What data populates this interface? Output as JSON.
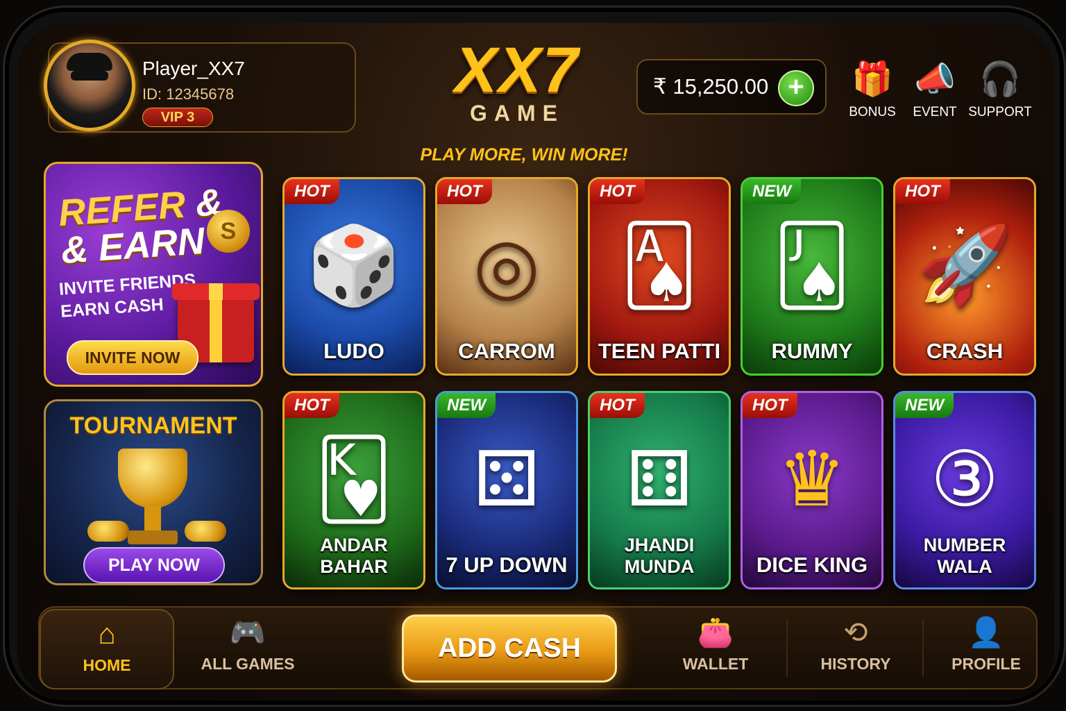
{
  "profile": {
    "name": "Player_XX7",
    "id": "ID: 12345678",
    "vip": "VIP 3"
  },
  "logo": {
    "main": "XX7",
    "sub": "GAME",
    "tagline": "PLAY MORE, WIN MORE!"
  },
  "balance": {
    "amount": "₹ 15,250.00",
    "add_symbol": "+"
  },
  "top_icons": [
    {
      "label": "BONUS",
      "icon": "gift-icon",
      "glyph": "🎁"
    },
    {
      "label": "EVENT",
      "icon": "megaphone-icon",
      "glyph": "📣"
    },
    {
      "label": "SUPPORT",
      "icon": "headset-icon",
      "glyph": "🎧"
    }
  ],
  "refer": {
    "title_line1": "REFER",
    "amp": "&",
    "title_line2": "& EARN",
    "sub_line1": "INVITE FRIENDS",
    "sub_line2": "EARN CASH",
    "button": "INVITE NOW",
    "coin_symbol": "S"
  },
  "tournament": {
    "title": "TOURNAMENT",
    "button": "PLAY NOW"
  },
  "games": [
    {
      "name": "LUDO",
      "badge": "HOT",
      "glyph": "🎲",
      "accent": "#1b4aa8"
    },
    {
      "name": "CARROM",
      "badge": "HOT",
      "glyph": "◎",
      "accent": "#b5824a"
    },
    {
      "name": "TEEN PATTI",
      "badge": "HOT",
      "glyph": "🂡",
      "accent": "#a01810"
    },
    {
      "name": "RUMMY",
      "badge": "NEW",
      "glyph": "🂫",
      "accent": "#1e7a1a"
    },
    {
      "name": "CRASH",
      "badge": "HOT",
      "glyph": "🚀",
      "accent": "#b0200e"
    },
    {
      "name": "ANDAR BAHAR",
      "badge": "HOT",
      "glyph": "🂾",
      "accent": "#1e6a1a"
    },
    {
      "name": "7 UP DOWN",
      "badge": "NEW",
      "glyph": "⚄",
      "accent": "#1a2a78"
    },
    {
      "name": "JHANDI MUNDA",
      "badge": "HOT",
      "glyph": "⚅",
      "accent": "#157a48"
    },
    {
      "name": "DICE KING",
      "badge": "HOT",
      "glyph": "♛",
      "accent": "#5a1a8a"
    },
    {
      "name": "NUMBER WALA",
      "badge": "NEW",
      "glyph": "③",
      "accent": "#3a1aa0"
    }
  ],
  "bottom_nav": {
    "home": {
      "label": "HOME",
      "glyph": "⌂"
    },
    "all_games": {
      "label": "ALL GAMES",
      "glyph": "🎮"
    },
    "add_cash": "ADD CASH",
    "wallet": {
      "label": "WALLET",
      "glyph": "👛"
    },
    "history": {
      "label": "HISTORY",
      "glyph": "⟲"
    },
    "profile": {
      "label": "PROFILE",
      "glyph": "👤"
    }
  },
  "colors": {
    "gold": "#ffc21a",
    "hot": "#e8321e",
    "new": "#3ab82a"
  }
}
